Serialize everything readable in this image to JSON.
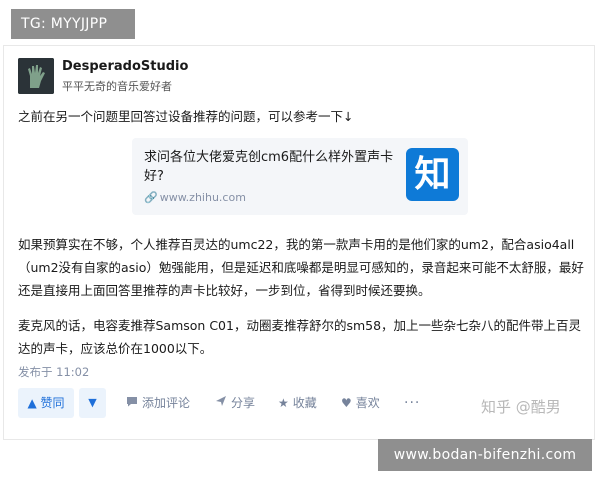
{
  "tag": "TG: MYYJJPP",
  "author": {
    "name": "DesperadoStudio",
    "bio": "平平无奇的音乐爱好者"
  },
  "intro": "之前在另一个问题里回答过设备推荐的问题，可以参考一下↓",
  "link_card": {
    "title": "求问各位大佬爱克创cm6配什么样外置声卡好?",
    "url": "www.zhihu.com",
    "logo_char": "知"
  },
  "paragraphs": [
    "如果预算实在不够，个人推荐百灵达的umc22，我的第一款声卡用的是他们家的um2，配合asio4all（um2没有自家的asio）勉强能用，但是延迟和底噪都是明显可感知的，录音起来可能不太舒服，最好还是直接用上面回答里推荐的声卡比较好，一步到位，省得到时候还要换。",
    "麦克风的话，电容麦推荐Samson C01，动圈麦推荐舒尔的sm58，加上一些杂七杂八的配件带上百灵达的声卡，应该总价在1000以下。"
  ],
  "published": "发布于 11:02",
  "actions": {
    "vote_label": "赞同",
    "comment_label": "添加评论",
    "share_label": "分享",
    "favorite_label": "收藏",
    "like_label": "喜欢",
    "more_label": "···"
  },
  "watermark": "知乎 @酷男",
  "footer": "www.bodan-bifenzhi.com",
  "colors": {
    "accent_blue": "#1e6fd9",
    "zhihu_blue": "#0e7ad7",
    "muted_text": "#8590a6",
    "badge_gray": "#8f8f8f"
  }
}
